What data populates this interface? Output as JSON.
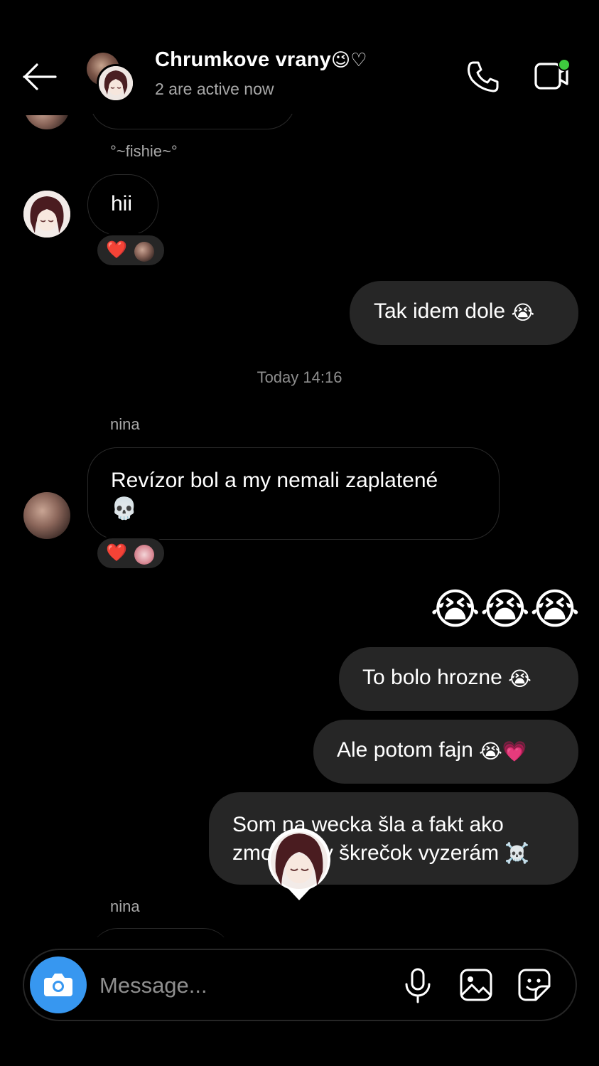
{
  "header": {
    "title": "Chrumkove vrany",
    "title_suffix": "😉♡",
    "subtitle": "2 are active now",
    "back_icon": "arrow-left-icon",
    "call_icon": "phone-icon",
    "video_icon": "video-camera-icon",
    "video_status_color": "#3ec93e"
  },
  "messages": [
    {
      "sender": "°~fishie~°",
      "text": "hii",
      "reaction": "❤️"
    },
    {
      "direction": "out",
      "text": "Tak idem dole",
      "emoji": "😭"
    },
    {
      "timestamp": "Today 14:16"
    },
    {
      "sender": "nina",
      "text": "Revízor bol a my nemali zaplatené",
      "emoji": "💀",
      "reaction": "❤️"
    },
    {
      "direction": "out",
      "big_emoji": "😭😭😭"
    },
    {
      "direction": "out",
      "text": "To bolo hrozne",
      "emoji": "😭"
    },
    {
      "direction": "out",
      "text": "Ale potom fajn",
      "emoji": "😭💗"
    },
    {
      "direction": "out",
      "text_line1": "Som na wecka šla a fakt ako",
      "text_line2_a": "zmo",
      "text_line2_b": "y škrečok vyzerám",
      "emoji": "☠️"
    },
    {
      "sender": "nina"
    }
  ],
  "composer": {
    "placeholder": "Message...",
    "camera_icon": "camera-icon",
    "mic_icon": "microphone-icon",
    "gallery_icon": "image-icon",
    "sticker_icon": "sticker-icon",
    "accent": "#3797f0"
  }
}
